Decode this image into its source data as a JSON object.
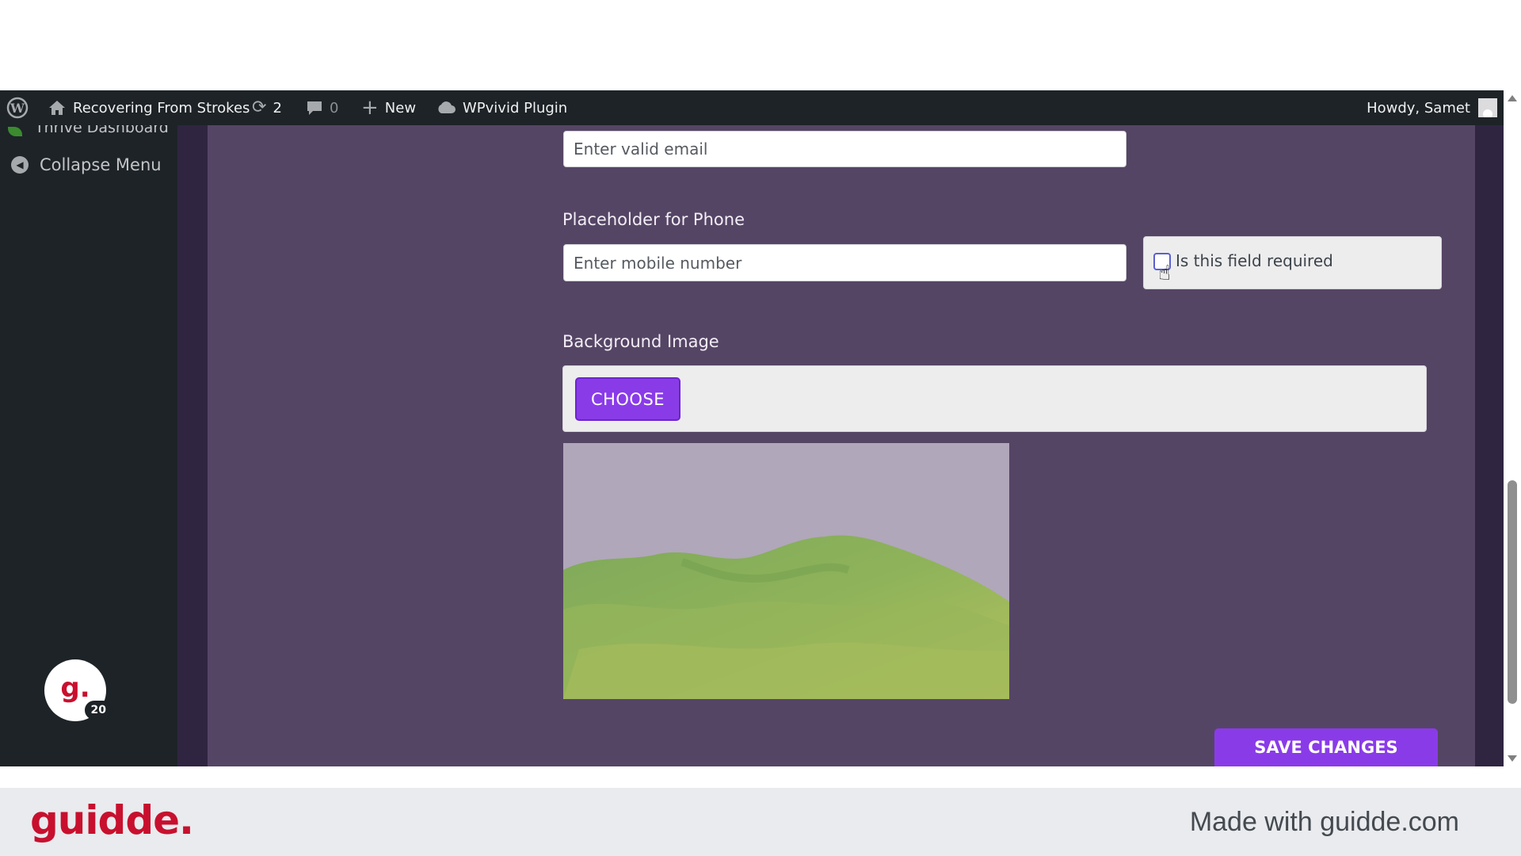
{
  "admin_bar": {
    "site_name": "Recovering From Strokes",
    "updates_count": "2",
    "comments_count": "0",
    "new_label": "New",
    "plugin_label": "WPvivid Plugin",
    "howdy": "Howdy, Samet",
    "icons": [
      "wordpress-logo-icon",
      "home-icon",
      "updates-icon",
      "comment-icon",
      "plus-icon",
      "cloud-icon"
    ]
  },
  "sidebar": {
    "partial_item": "Thrive Dashboard",
    "collapse_label": "Collapse Menu",
    "badge_letter": "g.",
    "badge_count": "20"
  },
  "form": {
    "email_placeholder": "Enter valid email",
    "phone_label": "Placeholder for Phone",
    "phone_placeholder": "Enter mobile number",
    "required_label": "Is this field required",
    "required_checked": false,
    "bg_image_label": "Background Image",
    "choose_button": "CHOOSE",
    "save_button": "SAVE CHANGES"
  },
  "footer": {
    "logo": "guidde.",
    "made_with": "Made with guidde.com"
  },
  "colors": {
    "admin_bar": "#1d2327",
    "panel": "#554565",
    "accent": "#8a3be8",
    "brand_red": "#c8102e"
  }
}
